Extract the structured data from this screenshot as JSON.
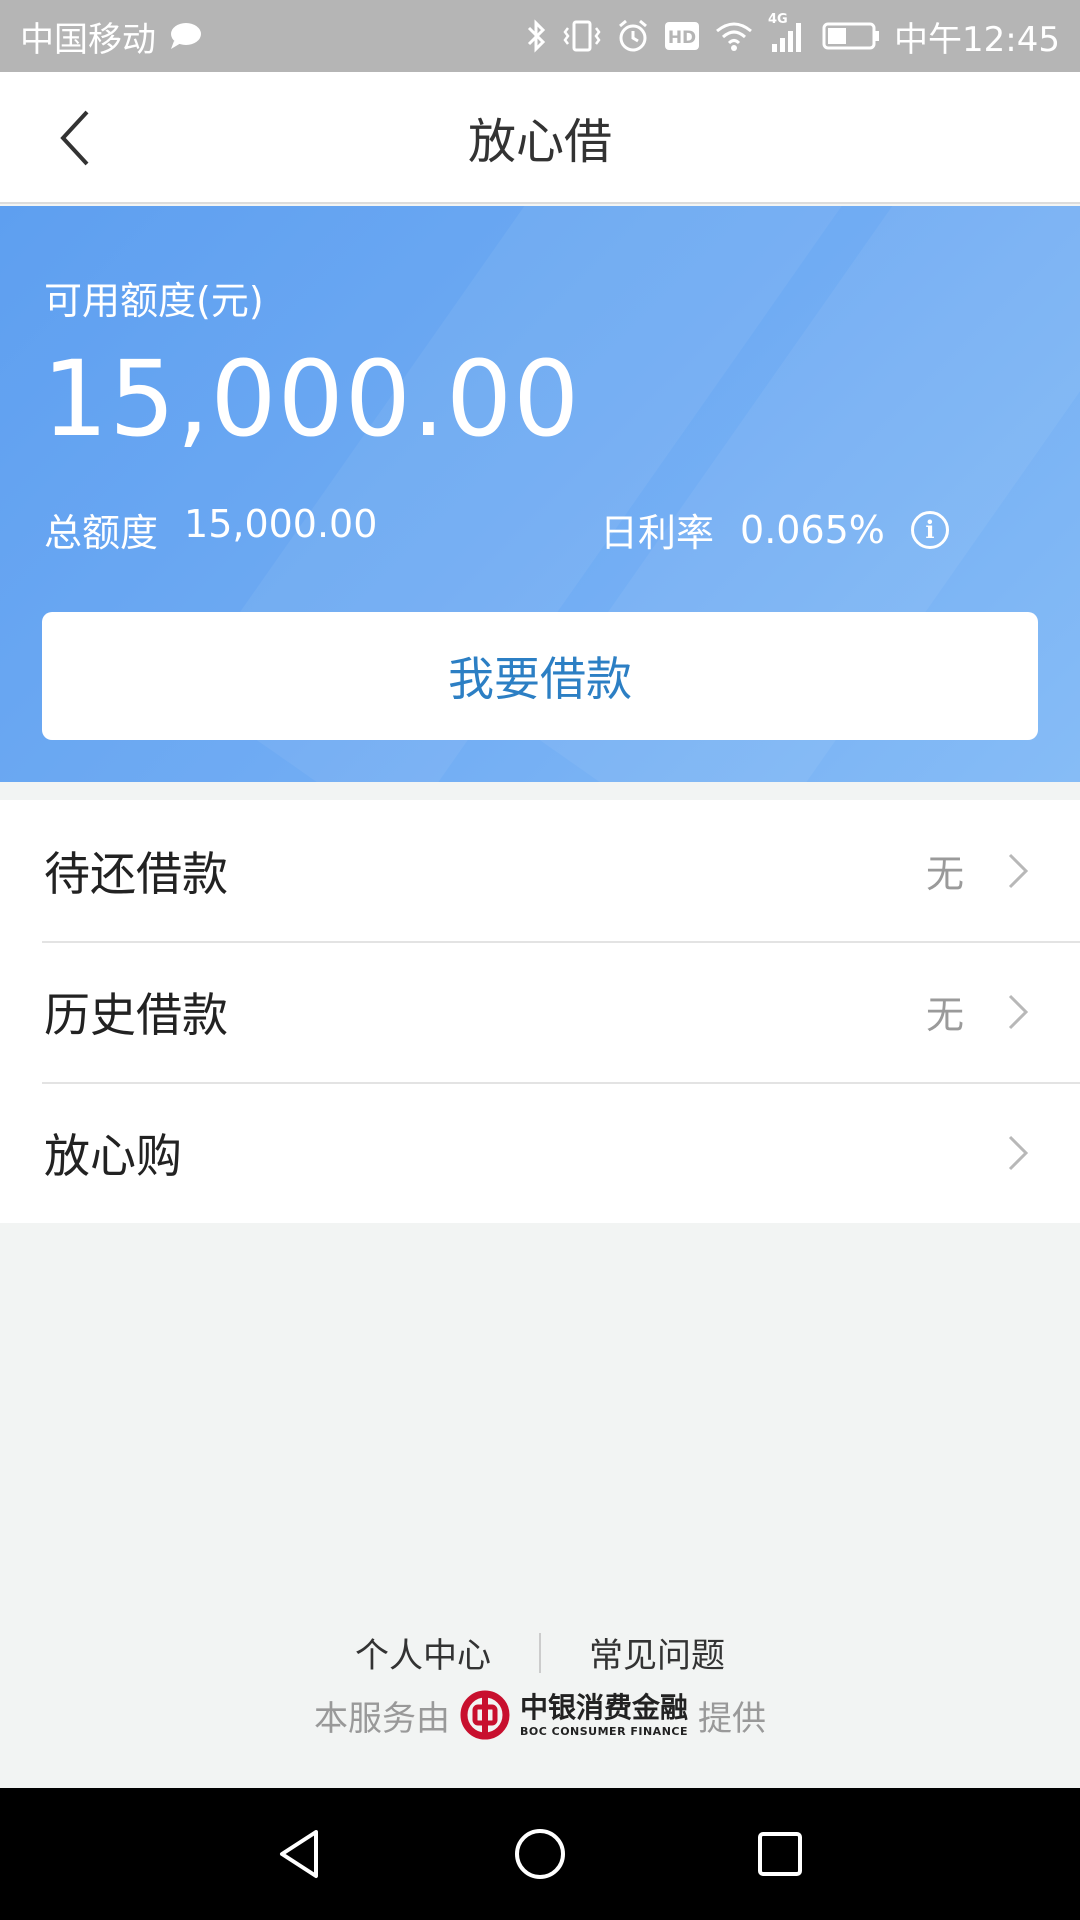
{
  "status_bar": {
    "carrier": "中国移动",
    "network": "4G",
    "time": "中午12:45",
    "icons": [
      "chat-bubble-icon",
      "bluetooth-icon",
      "vibrate-icon",
      "alarm-icon",
      "hd-icon",
      "wifi-icon",
      "signal-icon",
      "battery-icon"
    ],
    "hd_label": "HD"
  },
  "header": {
    "title": "放心借",
    "back_icon": "back-chevron-icon"
  },
  "banner": {
    "available_label": "可用额度(元)",
    "available_amount": "15,000.00",
    "total_label": "总额度",
    "total_value": "15,000.00",
    "rate_label": "日利率",
    "rate_value": "0.065%",
    "info_icon_glyph": "i",
    "borrow_button": "我要借款",
    "colors": {
      "gradient_start": "#5e9ff0",
      "gradient_end": "#86bcf6",
      "button_text": "#2c7fc4"
    }
  },
  "menu": {
    "items": [
      {
        "label": "待还借款",
        "value": "无"
      },
      {
        "label": "历史借款",
        "value": "无"
      },
      {
        "label": "放心购",
        "value": ""
      }
    ]
  },
  "footer": {
    "links": [
      "个人中心",
      "常见问题"
    ],
    "provider_prefix": "本服务由",
    "provider_name_cn": "中银消费金融",
    "provider_name_en": "BOC CONSUMER FINANCE",
    "provider_suffix": "提供",
    "logo_color": "#c8102e"
  },
  "nav": {
    "icons": [
      "back-triangle-icon",
      "home-circle-icon",
      "recents-square-icon"
    ]
  }
}
